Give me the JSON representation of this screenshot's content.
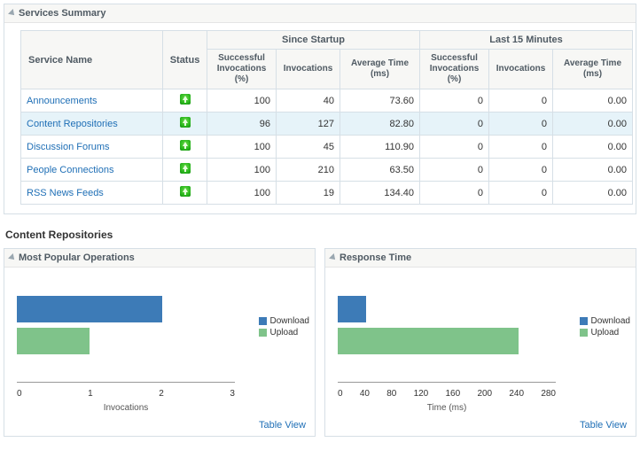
{
  "summary": {
    "title": "Services Summary",
    "col_service": "Service Name",
    "col_status": "Status",
    "group_startup": "Since Startup",
    "group_last15": "Last 15 Minutes",
    "col_succ": "Successful Invocations (%)",
    "col_inv": "Invocations",
    "col_avg": "Average Time (ms)",
    "rows": [
      {
        "name": "Announcements",
        "succ1": "100",
        "inv1": "40",
        "avg1": "73.60",
        "succ2": "0",
        "inv2": "0",
        "avg2": "0.00"
      },
      {
        "name": "Content Repositories",
        "succ1": "96",
        "inv1": "127",
        "avg1": "82.80",
        "succ2": "0",
        "inv2": "0",
        "avg2": "0.00"
      },
      {
        "name": "Discussion Forums",
        "succ1": "100",
        "inv1": "45",
        "avg1": "110.90",
        "succ2": "0",
        "inv2": "0",
        "avg2": "0.00"
      },
      {
        "name": "People Connections",
        "succ1": "100",
        "inv1": "210",
        "avg1": "63.50",
        "succ2": "0",
        "inv2": "0",
        "avg2": "0.00"
      },
      {
        "name": "RSS News Feeds",
        "succ1": "100",
        "inv1": "19",
        "avg1": "134.40",
        "succ2": "0",
        "inv2": "0",
        "avg2": "0.00"
      }
    ]
  },
  "detail_title": "Content Repositories",
  "chart_left": {
    "title": "Most Popular Operations",
    "table_view": "Table View"
  },
  "chart_right": {
    "title": "Response Time",
    "table_view": "Table View"
  },
  "legend": {
    "download": "Download",
    "upload": "Upload"
  },
  "chart_data": [
    {
      "type": "bar",
      "orientation": "horizontal",
      "title": "Most Popular Operations",
      "xlabel": "Invocations",
      "xlim": [
        0,
        3
      ],
      "xticks": [
        0,
        1,
        2,
        3
      ],
      "series": [
        {
          "name": "Download",
          "values": [
            2.0
          ],
          "color": "#3d7bb7"
        },
        {
          "name": "Upload",
          "values": [
            1.0
          ],
          "color": "#7fc38a"
        }
      ]
    },
    {
      "type": "bar",
      "orientation": "horizontal",
      "title": "Response Time",
      "xlabel": "Time (ms)",
      "xlim": [
        0,
        280
      ],
      "xticks": [
        0,
        40,
        80,
        120,
        160,
        200,
        240,
        280
      ],
      "series": [
        {
          "name": "Download",
          "values": [
            36
          ],
          "color": "#3d7bb7"
        },
        {
          "name": "Upload",
          "values": [
            232
          ],
          "color": "#7fc38a"
        }
      ]
    }
  ]
}
